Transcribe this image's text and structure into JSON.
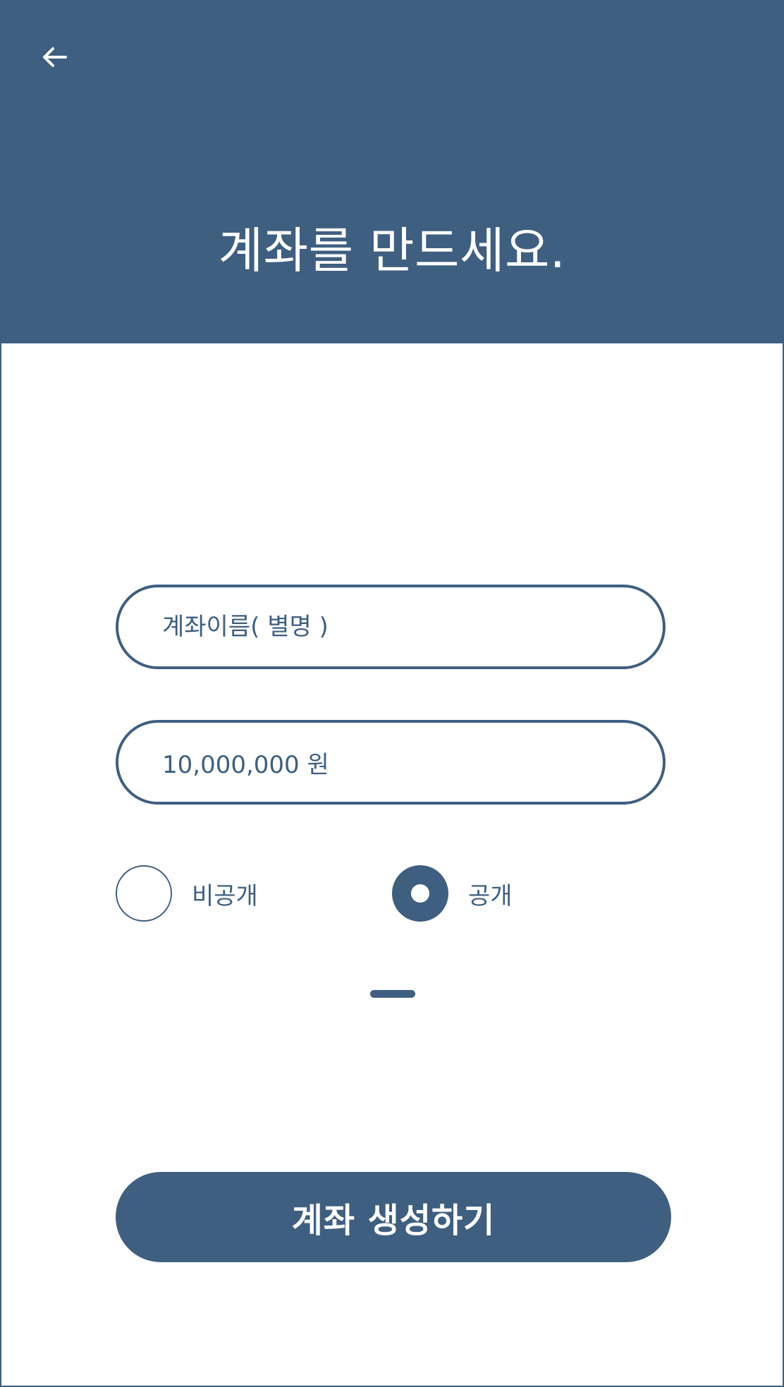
{
  "header": {
    "back_icon": "arrow-left-icon",
    "title": "계좌를 만드세요."
  },
  "form": {
    "name_placeholder": "계좌이름( 별명 )",
    "amount_value": "10,000,000 원"
  },
  "visibility": {
    "selected": "public",
    "options": [
      {
        "id": "private",
        "label": "비공개"
      },
      {
        "id": "public",
        "label": "공개"
      }
    ]
  },
  "actions": {
    "submit_label": "계좌 생성하기"
  },
  "colors": {
    "primary": "#3f5f81",
    "background": "#ffffff"
  }
}
